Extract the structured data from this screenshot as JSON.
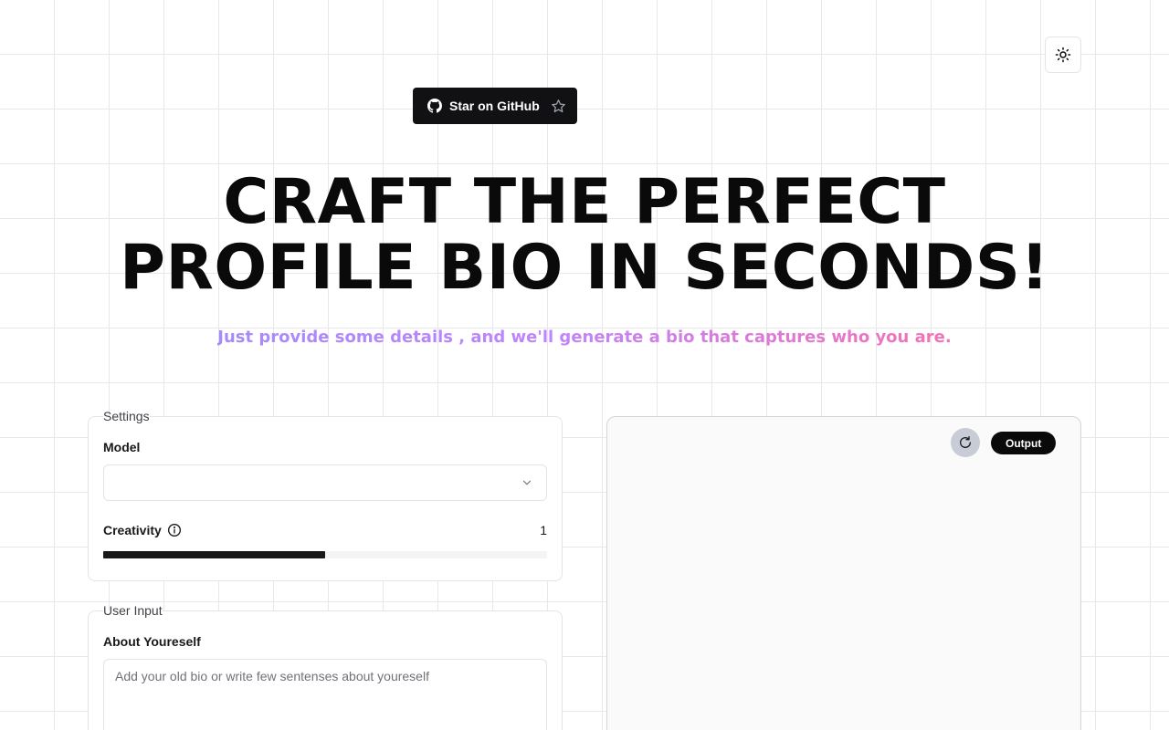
{
  "header": {
    "github_label": "Star on GitHub",
    "theme_toggle_icon": "sun-icon"
  },
  "hero": {
    "title_line1": "CRAFT THE PERFECT",
    "title_line2": "PROFILE BIO IN SECONDS!",
    "subtitle": "Just provide some details , and we'll generate a bio that captures who you are."
  },
  "settings": {
    "legend": "Settings",
    "model_label": "Model",
    "model_value": "",
    "creativity_label": "Creativity",
    "creativity_value": "1",
    "creativity_fraction": 0.5
  },
  "user_input": {
    "legend": "User Input",
    "about_label": "About Youreself",
    "about_placeholder": "Add your old bio or write few sentenses about youreself"
  },
  "output": {
    "badge": "Output"
  },
  "colors": {
    "gradient_start": "#a78bfa",
    "gradient_end": "#f472b6",
    "primary": "#111113"
  }
}
